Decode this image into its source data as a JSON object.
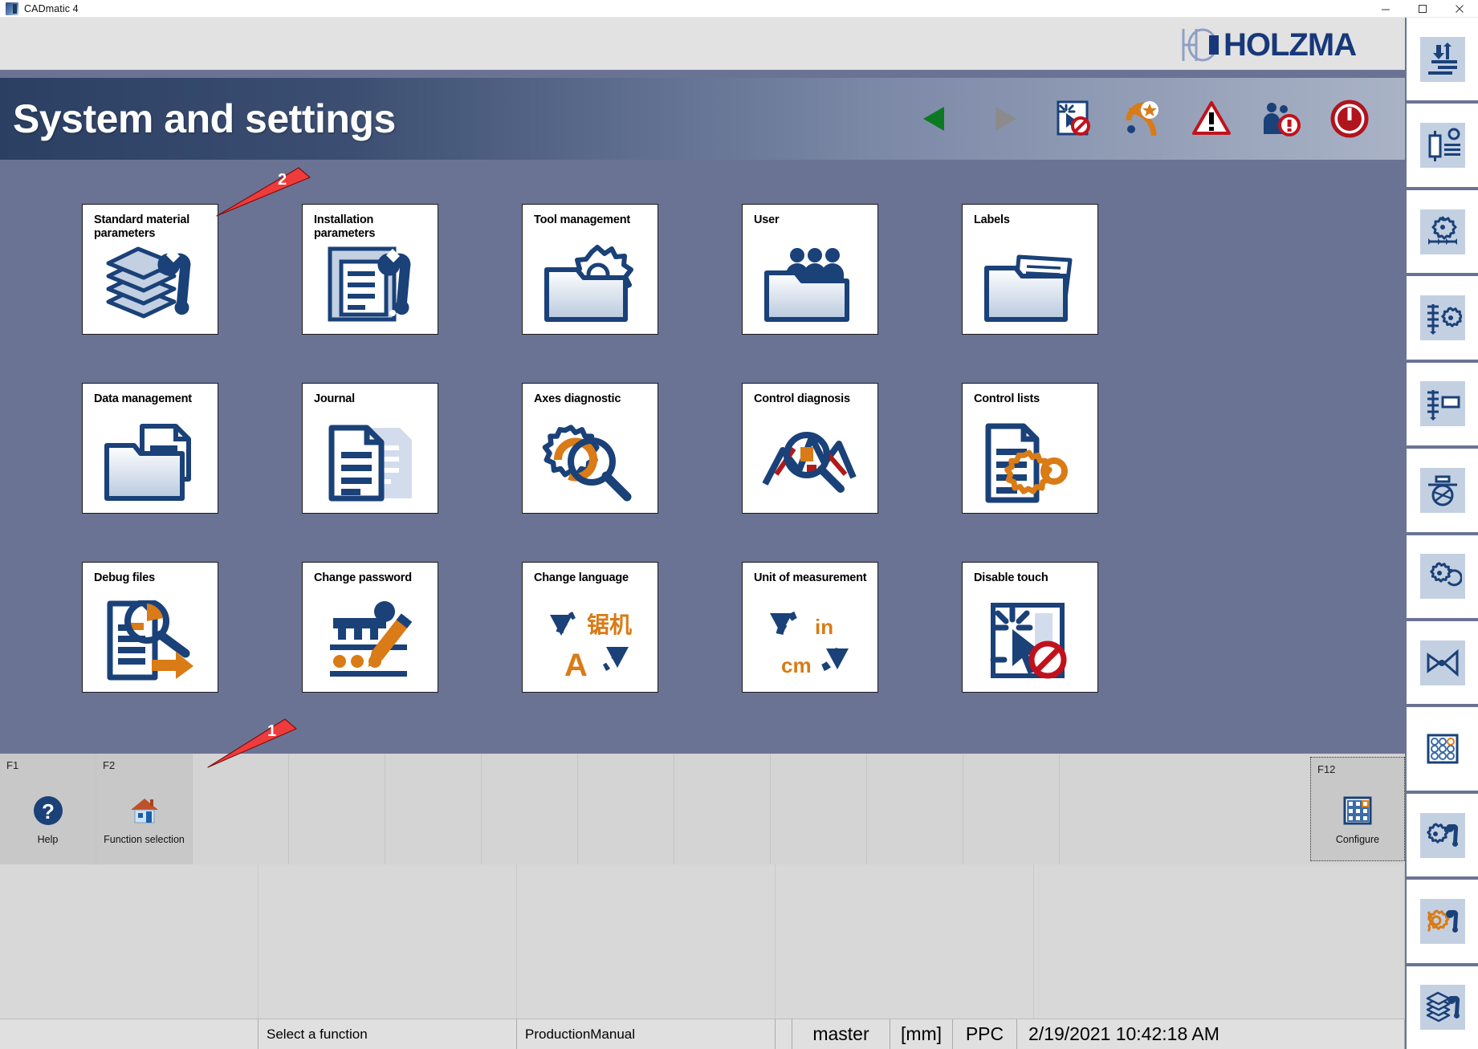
{
  "window": {
    "title": "CADmatic 4",
    "app_icon": "cadmatic-app-icon",
    "minimize": "–",
    "maximize": "☐",
    "close": "✕"
  },
  "brand": {
    "name": "HOLZMA",
    "mark": "holzma-hc-logo"
  },
  "header": {
    "title": "System and settings",
    "icons": [
      {
        "name": "back-arrow-icon",
        "label": "Back"
      },
      {
        "name": "forward-arrow-icon",
        "label": "Forward"
      },
      {
        "name": "touch-disabled-icon",
        "label": "Touch disabled"
      },
      {
        "name": "signal-favorite-icon",
        "label": "Signal"
      },
      {
        "name": "warning-triangle-icon",
        "label": "Warning"
      },
      {
        "name": "user-info-icon",
        "label": "User"
      },
      {
        "name": "power-off-icon",
        "label": "Shutdown"
      }
    ]
  },
  "tiles": [
    {
      "label": "Standard material parameters",
      "icon": "layers-wrench-icon"
    },
    {
      "label": "Installation parameters",
      "icon": "document-wrench-icon"
    },
    {
      "label": "Tool management",
      "icon": "folder-gear-icon"
    },
    {
      "label": "User",
      "icon": "folder-users-icon"
    },
    {
      "label": "Labels",
      "icon": "folder-label-icon"
    },
    {
      "label": "Data management",
      "icon": "folder-document-icon"
    },
    {
      "label": "Journal",
      "icon": "document-lines-icon"
    },
    {
      "label": "Axes diagnostic",
      "icon": "gear-magnifier-icon"
    },
    {
      "label": "Control diagnosis",
      "icon": "graph-magnifier-icon"
    },
    {
      "label": "Control lists",
      "icon": "list-gear-icon"
    },
    {
      "label": "Debug files",
      "icon": "debug-magnifier-arrow-icon"
    },
    {
      "label": "Change password",
      "icon": "key-pencil-icon"
    },
    {
      "label": "Change language",
      "icon": "language-swap-icon"
    },
    {
      "label": "Unit of measurement",
      "icon": "unit-swap-icon"
    },
    {
      "label": "Disable touch",
      "icon": "touch-disabled-icon"
    }
  ],
  "tile_extra": {
    "language_cjk": "锯机",
    "language_latin": "A",
    "unit_in": "in",
    "unit_cm": "cm"
  },
  "callouts": [
    {
      "number": "1",
      "target": "function-key-bar"
    },
    {
      "number": "2",
      "target": "standard-material-parameters-tile"
    }
  ],
  "function_keys": [
    {
      "key": "F1",
      "label": "Help",
      "icon": "question-mark-icon"
    },
    {
      "key": "F2",
      "label": "Function selection",
      "icon": "home-house-icon"
    }
  ],
  "function_key_f12": {
    "key": "F12",
    "label": "Configure",
    "icon": "grid-configure-icon"
  },
  "status": {
    "message": "Select a function",
    "mode": "ProductionManual",
    "user": "master",
    "unit": "[mm]",
    "system": "PPC",
    "datetime": "2/19/2021 10:42:18 AM"
  },
  "rail": [
    {
      "icon": "feed-alignment-icon"
    },
    {
      "icon": "cylinder-settings-icon"
    },
    {
      "icon": "gear-scale-icon"
    },
    {
      "icon": "scale-gear-icon"
    },
    {
      "icon": "scale-bar-icon"
    },
    {
      "icon": "saw-blade-icon"
    },
    {
      "icon": "gear-rotate-icon"
    },
    {
      "icon": "bowtie-icon"
    },
    {
      "icon": "grid-dots-icon"
    },
    {
      "icon": "gear-wrench-icon"
    },
    {
      "icon": "gears-wrench-orange-icon"
    },
    {
      "icon": "layers-wrench-icon"
    }
  ],
  "colors": {
    "brand_blue": "#17387a",
    "panel_blue": "#6b7394",
    "accent_orange": "#d97b16",
    "warning_red": "#c1121c",
    "callout_red": "#ef3b3b",
    "icon_navy": "#1a4178",
    "tile_white": "#ffffff",
    "chrome_gray": "#d8d8d8"
  }
}
